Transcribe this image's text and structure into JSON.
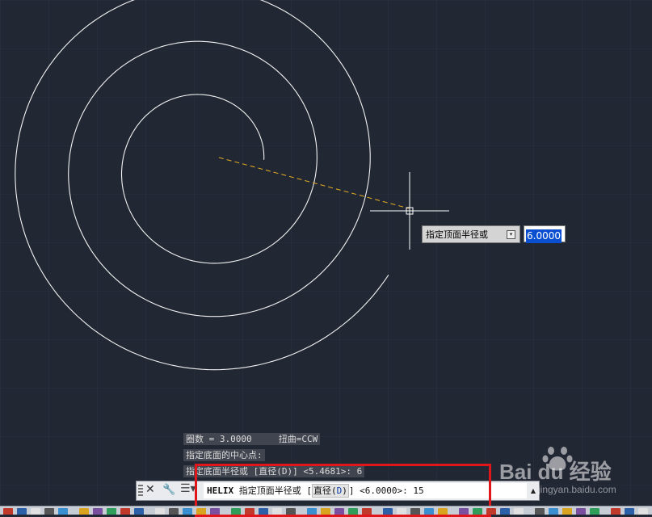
{
  "dynamic_input": {
    "prompt": "指定顶面半径或",
    "value": "6.0000",
    "dropdown_icon": "chevron-down-icon"
  },
  "command_history": [
    "圈数 = 3.0000     扭曲=CCW",
    "指定底面的中心点:",
    "指定底面半径或 [直径(D)] <5.4681>: 6"
  ],
  "command_line": {
    "command_name": "HELIX",
    "prompt_before": "指定顶面半径或 [",
    "option_label": "直径(",
    "option_key": "D",
    "option_close": ")",
    "prompt_after": "] <6.0000>: ",
    "typed_value": "15",
    "close_icon": "close-icon",
    "customize_icon": "wrench-icon",
    "recent_icon": "recent-commands-icon"
  },
  "watermark": {
    "brand": "Bai du 经验",
    "site": "jingyan.baidu.com"
  },
  "colors": {
    "canvas": "#222734",
    "helix": "#f2f2f2",
    "rubber_band": "#e8b020",
    "highlight": "#e0161b"
  }
}
